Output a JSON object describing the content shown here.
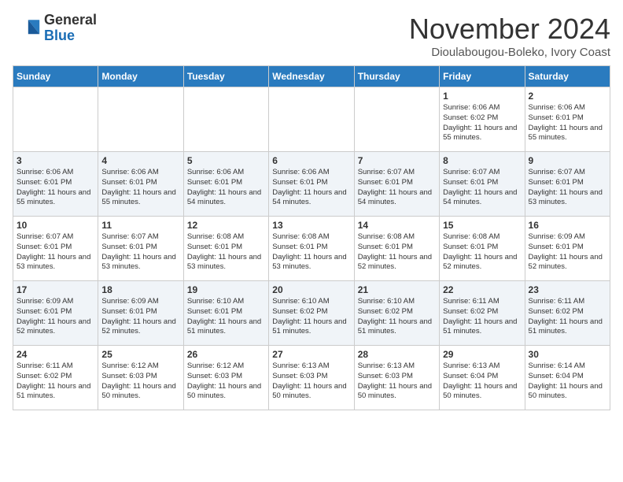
{
  "logo": {
    "general": "General",
    "blue": "Blue"
  },
  "header": {
    "month": "November 2024",
    "location": "Dioulabougou-Boleko, Ivory Coast"
  },
  "days_of_week": [
    "Sunday",
    "Monday",
    "Tuesday",
    "Wednesday",
    "Thursday",
    "Friday",
    "Saturday"
  ],
  "weeks": [
    [
      {
        "num": "",
        "info": ""
      },
      {
        "num": "",
        "info": ""
      },
      {
        "num": "",
        "info": ""
      },
      {
        "num": "",
        "info": ""
      },
      {
        "num": "",
        "info": ""
      },
      {
        "num": "1",
        "info": "Sunrise: 6:06 AM\nSunset: 6:02 PM\nDaylight: 11 hours and 55 minutes."
      },
      {
        "num": "2",
        "info": "Sunrise: 6:06 AM\nSunset: 6:01 PM\nDaylight: 11 hours and 55 minutes."
      }
    ],
    [
      {
        "num": "3",
        "info": "Sunrise: 6:06 AM\nSunset: 6:01 PM\nDaylight: 11 hours and 55 minutes."
      },
      {
        "num": "4",
        "info": "Sunrise: 6:06 AM\nSunset: 6:01 PM\nDaylight: 11 hours and 55 minutes."
      },
      {
        "num": "5",
        "info": "Sunrise: 6:06 AM\nSunset: 6:01 PM\nDaylight: 11 hours and 54 minutes."
      },
      {
        "num": "6",
        "info": "Sunrise: 6:06 AM\nSunset: 6:01 PM\nDaylight: 11 hours and 54 minutes."
      },
      {
        "num": "7",
        "info": "Sunrise: 6:07 AM\nSunset: 6:01 PM\nDaylight: 11 hours and 54 minutes."
      },
      {
        "num": "8",
        "info": "Sunrise: 6:07 AM\nSunset: 6:01 PM\nDaylight: 11 hours and 54 minutes."
      },
      {
        "num": "9",
        "info": "Sunrise: 6:07 AM\nSunset: 6:01 PM\nDaylight: 11 hours and 53 minutes."
      }
    ],
    [
      {
        "num": "10",
        "info": "Sunrise: 6:07 AM\nSunset: 6:01 PM\nDaylight: 11 hours and 53 minutes."
      },
      {
        "num": "11",
        "info": "Sunrise: 6:07 AM\nSunset: 6:01 PM\nDaylight: 11 hours and 53 minutes."
      },
      {
        "num": "12",
        "info": "Sunrise: 6:08 AM\nSunset: 6:01 PM\nDaylight: 11 hours and 53 minutes."
      },
      {
        "num": "13",
        "info": "Sunrise: 6:08 AM\nSunset: 6:01 PM\nDaylight: 11 hours and 53 minutes."
      },
      {
        "num": "14",
        "info": "Sunrise: 6:08 AM\nSunset: 6:01 PM\nDaylight: 11 hours and 52 minutes."
      },
      {
        "num": "15",
        "info": "Sunrise: 6:08 AM\nSunset: 6:01 PM\nDaylight: 11 hours and 52 minutes."
      },
      {
        "num": "16",
        "info": "Sunrise: 6:09 AM\nSunset: 6:01 PM\nDaylight: 11 hours and 52 minutes."
      }
    ],
    [
      {
        "num": "17",
        "info": "Sunrise: 6:09 AM\nSunset: 6:01 PM\nDaylight: 11 hours and 52 minutes."
      },
      {
        "num": "18",
        "info": "Sunrise: 6:09 AM\nSunset: 6:01 PM\nDaylight: 11 hours and 52 minutes."
      },
      {
        "num": "19",
        "info": "Sunrise: 6:10 AM\nSunset: 6:01 PM\nDaylight: 11 hours and 51 minutes."
      },
      {
        "num": "20",
        "info": "Sunrise: 6:10 AM\nSunset: 6:02 PM\nDaylight: 11 hours and 51 minutes."
      },
      {
        "num": "21",
        "info": "Sunrise: 6:10 AM\nSunset: 6:02 PM\nDaylight: 11 hours and 51 minutes."
      },
      {
        "num": "22",
        "info": "Sunrise: 6:11 AM\nSunset: 6:02 PM\nDaylight: 11 hours and 51 minutes."
      },
      {
        "num": "23",
        "info": "Sunrise: 6:11 AM\nSunset: 6:02 PM\nDaylight: 11 hours and 51 minutes."
      }
    ],
    [
      {
        "num": "24",
        "info": "Sunrise: 6:11 AM\nSunset: 6:02 PM\nDaylight: 11 hours and 51 minutes."
      },
      {
        "num": "25",
        "info": "Sunrise: 6:12 AM\nSunset: 6:03 PM\nDaylight: 11 hours and 50 minutes."
      },
      {
        "num": "26",
        "info": "Sunrise: 6:12 AM\nSunset: 6:03 PM\nDaylight: 11 hours and 50 minutes."
      },
      {
        "num": "27",
        "info": "Sunrise: 6:13 AM\nSunset: 6:03 PM\nDaylight: 11 hours and 50 minutes."
      },
      {
        "num": "28",
        "info": "Sunrise: 6:13 AM\nSunset: 6:03 PM\nDaylight: 11 hours and 50 minutes."
      },
      {
        "num": "29",
        "info": "Sunrise: 6:13 AM\nSunset: 6:04 PM\nDaylight: 11 hours and 50 minutes."
      },
      {
        "num": "30",
        "info": "Sunrise: 6:14 AM\nSunset: 6:04 PM\nDaylight: 11 hours and 50 minutes."
      }
    ]
  ]
}
